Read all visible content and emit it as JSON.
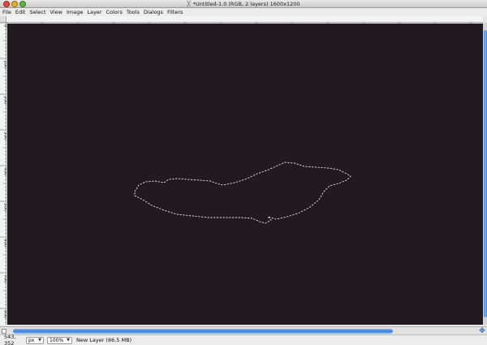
{
  "window": {
    "title": "*Untitled-1.0 (RGB, 2 layers) 1600x1200"
  },
  "menu": {
    "items": [
      "File",
      "Edit",
      "Select",
      "View",
      "Image",
      "Layer",
      "Colors",
      "Tools",
      "Dialogs",
      "Filters"
    ]
  },
  "ruler": {
    "horizontal_labels": [
      "0",
      "100",
      "200",
      "300",
      "400",
      "500",
      "600",
      "700",
      "800",
      "900",
      "1000",
      "1100",
      "1200",
      "1300",
      "1400",
      "1500"
    ],
    "vertical_labels": [
      "0",
      "100",
      "200",
      "300",
      "400",
      "500",
      "600",
      "700",
      "800",
      "900",
      "1000",
      "1100"
    ]
  },
  "canvas": {
    "background": "#211a21",
    "selection_color": "#e8e8e8"
  },
  "status": {
    "pointer_coords": "543, 352",
    "unit": "px",
    "zoom": "100%",
    "message": "New Layer (86.5 MB)"
  },
  "colors": {
    "scroll_accent": "#3b7ed8"
  }
}
